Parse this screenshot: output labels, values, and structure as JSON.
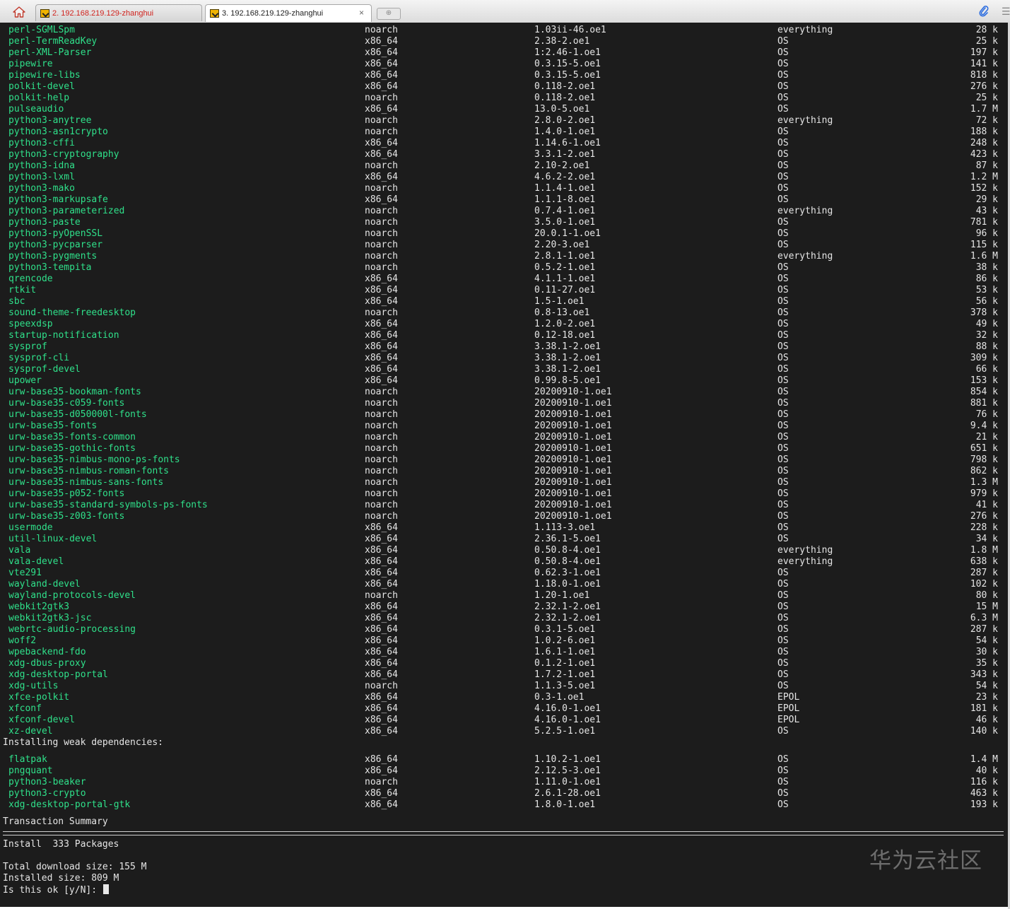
{
  "tabs": [
    {
      "label": "2. 192.168.219.129-zhanghui",
      "active": false
    },
    {
      "label": "3. 192.168.219.129-zhanghui",
      "active": true
    }
  ],
  "icons": {
    "home": "home-icon",
    "new_tab": "new-tab-icon",
    "close": "close-icon",
    "attach": "paperclip-icon",
    "menu": "menu-icon"
  },
  "tab_close_glyph": "×",
  "colors": {
    "terminal_bg": "#1c1c1c",
    "package_name": "#2fe08a",
    "text": "#e5e5e5",
    "active_tab_text": "#222222",
    "inactive_tab_text": "#d0231e"
  },
  "packages": [
    [
      "perl-SGMLSpm",
      "noarch",
      "1.03ii-46.oe1",
      "everything",
      "28 k"
    ],
    [
      "perl-TermReadKey",
      "x86_64",
      "2.38-2.oe1",
      "OS",
      "25 k"
    ],
    [
      "perl-XML-Parser",
      "x86_64",
      "1:2.46-1.oe1",
      "OS",
      "197 k"
    ],
    [
      "pipewire",
      "x86_64",
      "0.3.15-5.oe1",
      "OS",
      "141 k"
    ],
    [
      "pipewire-libs",
      "x86_64",
      "0.3.15-5.oe1",
      "OS",
      "818 k"
    ],
    [
      "polkit-devel",
      "x86_64",
      "0.118-2.oe1",
      "OS",
      "276 k"
    ],
    [
      "polkit-help",
      "noarch",
      "0.118-2.oe1",
      "OS",
      "25 k"
    ],
    [
      "pulseaudio",
      "x86_64",
      "13.0-5.oe1",
      "OS",
      "1.7 M"
    ],
    [
      "python3-anytree",
      "noarch",
      "2.8.0-2.oe1",
      "everything",
      "72 k"
    ],
    [
      "python3-asn1crypto",
      "noarch",
      "1.4.0-1.oe1",
      "OS",
      "188 k"
    ],
    [
      "python3-cffi",
      "x86_64",
      "1.14.6-1.oe1",
      "OS",
      "248 k"
    ],
    [
      "python3-cryptography",
      "x86_64",
      "3.3.1-2.oe1",
      "OS",
      "423 k"
    ],
    [
      "python3-idna",
      "noarch",
      "2.10-2.oe1",
      "OS",
      "87 k"
    ],
    [
      "python3-lxml",
      "x86_64",
      "4.6.2-2.oe1",
      "OS",
      "1.2 M"
    ],
    [
      "python3-mako",
      "noarch",
      "1.1.4-1.oe1",
      "OS",
      "152 k"
    ],
    [
      "python3-markupsafe",
      "x86_64",
      "1.1.1-8.oe1",
      "OS",
      "29 k"
    ],
    [
      "python3-parameterized",
      "noarch",
      "0.7.4-1.oe1",
      "everything",
      "43 k"
    ],
    [
      "python3-paste",
      "noarch",
      "3.5.0-1.oe1",
      "OS",
      "781 k"
    ],
    [
      "python3-pyOpenSSL",
      "noarch",
      "20.0.1-1.oe1",
      "OS",
      "96 k"
    ],
    [
      "python3-pycparser",
      "noarch",
      "2.20-3.oe1",
      "OS",
      "115 k"
    ],
    [
      "python3-pygments",
      "noarch",
      "2.8.1-1.oe1",
      "everything",
      "1.6 M"
    ],
    [
      "python3-tempita",
      "noarch",
      "0.5.2-1.oe1",
      "OS",
      "38 k"
    ],
    [
      "qrencode",
      "x86_64",
      "4.1.1-1.oe1",
      "OS",
      "86 k"
    ],
    [
      "rtkit",
      "x86_64",
      "0.11-27.oe1",
      "OS",
      "53 k"
    ],
    [
      "sbc",
      "x86_64",
      "1.5-1.oe1",
      "OS",
      "56 k"
    ],
    [
      "sound-theme-freedesktop",
      "noarch",
      "0.8-13.oe1",
      "OS",
      "378 k"
    ],
    [
      "speexdsp",
      "x86_64",
      "1.2.0-2.oe1",
      "OS",
      "49 k"
    ],
    [
      "startup-notification",
      "x86_64",
      "0.12-18.oe1",
      "OS",
      "32 k"
    ],
    [
      "sysprof",
      "x86_64",
      "3.38.1-2.oe1",
      "OS",
      "88 k"
    ],
    [
      "sysprof-cli",
      "x86_64",
      "3.38.1-2.oe1",
      "OS",
      "309 k"
    ],
    [
      "sysprof-devel",
      "x86_64",
      "3.38.1-2.oe1",
      "OS",
      "66 k"
    ],
    [
      "upower",
      "x86_64",
      "0.99.8-5.oe1",
      "OS",
      "153 k"
    ],
    [
      "urw-base35-bookman-fonts",
      "noarch",
      "20200910-1.oe1",
      "OS",
      "854 k"
    ],
    [
      "urw-base35-c059-fonts",
      "noarch",
      "20200910-1.oe1",
      "OS",
      "881 k"
    ],
    [
      "urw-base35-d050000l-fonts",
      "noarch",
      "20200910-1.oe1",
      "OS",
      "76 k"
    ],
    [
      "urw-base35-fonts",
      "noarch",
      "20200910-1.oe1",
      "OS",
      "9.4 k"
    ],
    [
      "urw-base35-fonts-common",
      "noarch",
      "20200910-1.oe1",
      "OS",
      "21 k"
    ],
    [
      "urw-base35-gothic-fonts",
      "noarch",
      "20200910-1.oe1",
      "OS",
      "651 k"
    ],
    [
      "urw-base35-nimbus-mono-ps-fonts",
      "noarch",
      "20200910-1.oe1",
      "OS",
      "798 k"
    ],
    [
      "urw-base35-nimbus-roman-fonts",
      "noarch",
      "20200910-1.oe1",
      "OS",
      "862 k"
    ],
    [
      "urw-base35-nimbus-sans-fonts",
      "noarch",
      "20200910-1.oe1",
      "OS",
      "1.3 M"
    ],
    [
      "urw-base35-p052-fonts",
      "noarch",
      "20200910-1.oe1",
      "OS",
      "979 k"
    ],
    [
      "urw-base35-standard-symbols-ps-fonts",
      "noarch",
      "20200910-1.oe1",
      "OS",
      "41 k"
    ],
    [
      "urw-base35-z003-fonts",
      "noarch",
      "20200910-1.oe1",
      "OS",
      "276 k"
    ],
    [
      "usermode",
      "x86_64",
      "1.113-3.oe1",
      "OS",
      "228 k"
    ],
    [
      "util-linux-devel",
      "x86_64",
      "2.36.1-5.oe1",
      "OS",
      "34 k"
    ],
    [
      "vala",
      "x86_64",
      "0.50.8-4.oe1",
      "everything",
      "1.8 M"
    ],
    [
      "vala-devel",
      "x86_64",
      "0.50.8-4.oe1",
      "everything",
      "638 k"
    ],
    [
      "vte291",
      "x86_64",
      "0.62.3-1.oe1",
      "OS",
      "287 k"
    ],
    [
      "wayland-devel",
      "x86_64",
      "1.18.0-1.oe1",
      "OS",
      "102 k"
    ],
    [
      "wayland-protocols-devel",
      "noarch",
      "1.20-1.oe1",
      "OS",
      "80 k"
    ],
    [
      "webkit2gtk3",
      "x86_64",
      "2.32.1-2.oe1",
      "OS",
      "15 M"
    ],
    [
      "webkit2gtk3-jsc",
      "x86_64",
      "2.32.1-2.oe1",
      "OS",
      "6.3 M"
    ],
    [
      "webrtc-audio-processing",
      "x86_64",
      "0.3.1-5.oe1",
      "OS",
      "287 k"
    ],
    [
      "woff2",
      "x86_64",
      "1.0.2-6.oe1",
      "OS",
      "54 k"
    ],
    [
      "wpebackend-fdo",
      "x86_64",
      "1.6.1-1.oe1",
      "OS",
      "30 k"
    ],
    [
      "xdg-dbus-proxy",
      "x86_64",
      "0.1.2-1.oe1",
      "OS",
      "35 k"
    ],
    [
      "xdg-desktop-portal",
      "x86_64",
      "1.7.2-1.oe1",
      "OS",
      "343 k"
    ],
    [
      "xdg-utils",
      "noarch",
      "1.1.3-5.oe1",
      "OS",
      "54 k"
    ],
    [
      "xfce-polkit",
      "x86_64",
      "0.3-1.oe1",
      "EPOL",
      "23 k"
    ],
    [
      "xfconf",
      "x86_64",
      "4.16.0-1.oe1",
      "EPOL",
      "181 k"
    ],
    [
      "xfconf-devel",
      "x86_64",
      "4.16.0-1.oe1",
      "EPOL",
      "46 k"
    ],
    [
      "xz-devel",
      "x86_64",
      "5.2.5-1.oe1",
      "OS",
      "140 k"
    ]
  ],
  "weak_header": "Installing weak dependencies:",
  "weak_packages": [
    [
      "flatpak",
      "x86_64",
      "1.10.2-1.oe1",
      "OS",
      "1.4 M"
    ],
    [
      "pngquant",
      "x86_64",
      "2.12.5-3.oe1",
      "OS",
      "40 k"
    ],
    [
      "python3-beaker",
      "noarch",
      "1.11.0-1.oe1",
      "OS",
      "116 k"
    ],
    [
      "python3-crypto",
      "x86_64",
      "2.6.1-28.oe1",
      "OS",
      "463 k"
    ],
    [
      "xdg-desktop-portal-gtk",
      "x86_64",
      "1.8.0-1.oe1",
      "OS",
      "193 k"
    ]
  ],
  "summary": {
    "title": "Transaction Summary",
    "install_line": "Install  333 Packages",
    "download_line": "Total download size: 155 M",
    "installed_line": "Installed size: 809 M",
    "prompt": "Is this ok [y/N]: "
  },
  "watermark": "华为云社区"
}
